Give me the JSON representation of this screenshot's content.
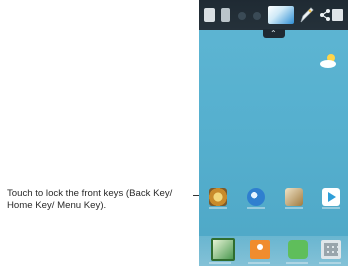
{
  "annotation": {
    "callout_text": "Touch to lock the front keys (Back Key/ Home Key/ Menu Key)."
  },
  "icons": {
    "status_bar": [
      "screenshot-icon",
      "app-icon",
      "dot-icon",
      "dot-icon",
      "qmemo-icon",
      "pen-icon",
      "share-icon",
      "save-icon"
    ],
    "home": [
      "weather-icon",
      "app-icon",
      "globe-icon",
      "camera-icon",
      "play-store-icon"
    ],
    "dock": [
      "lock-front-keys-icon",
      "contacts-icon",
      "messaging-icon",
      "apps-grid-icon"
    ]
  },
  "colors": {
    "wallpaper": "#56b0cf",
    "status_bar": "#1f2a33"
  }
}
